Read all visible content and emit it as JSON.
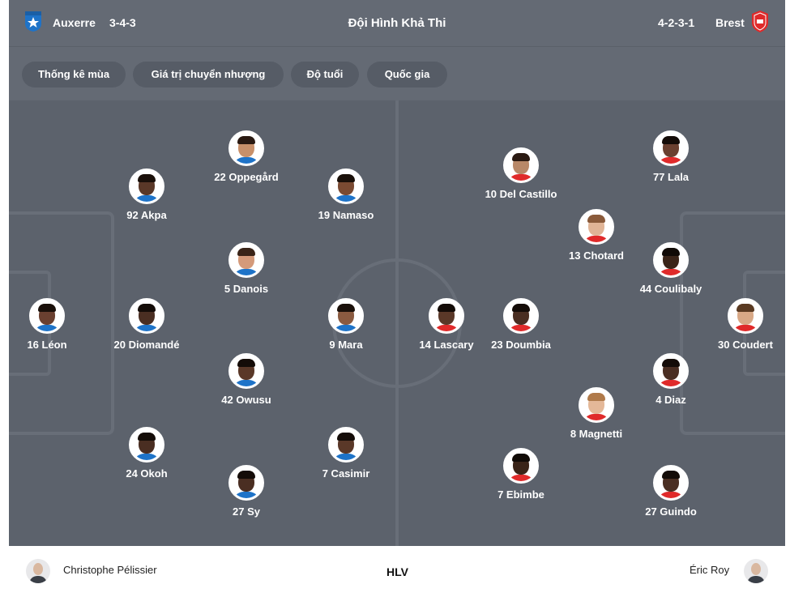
{
  "header": {
    "home_team": "Auxerre",
    "home_formation": "3-4-3",
    "title": "Đội Hình Khả Thi",
    "away_formation": "4-2-3-1",
    "away_team": "Brest"
  },
  "filters": [
    "Thống kê mùa",
    "Giá trị chuyển nhượng",
    "Độ tuổi",
    "Quốc gia"
  ],
  "home_players": [
    "22 Oppegård",
    "92 Akpa",
    "19 Namaso",
    "5 Danois",
    "16 Léon",
    "20 Diomandé",
    "9 Mara",
    "42 Owusu",
    "24 Okoh",
    "7 Casimir",
    "27 Sy"
  ],
  "away_players": [
    "77 Lala",
    "10 Del Castillo",
    "13 Chotard",
    "44 Coulibaly",
    "14 Lascary",
    "23 Doumbia",
    "30 Coudert",
    "4 Diaz",
    "8 Magnetti",
    "7 Ebimbe",
    "27 Guindo"
  ],
  "footer": {
    "home_coach": "Christophe Pélissier",
    "label": "HLV",
    "away_coach": "Éric Roy"
  },
  "colors": {
    "header_bg": "#646a74",
    "pitch_bg": "#5c626c",
    "pitch_lines": "#686e78",
    "pill_bg": "#565c66",
    "auxerre_crest": "#1e73c8",
    "brest_crest": "#e02a2a"
  }
}
